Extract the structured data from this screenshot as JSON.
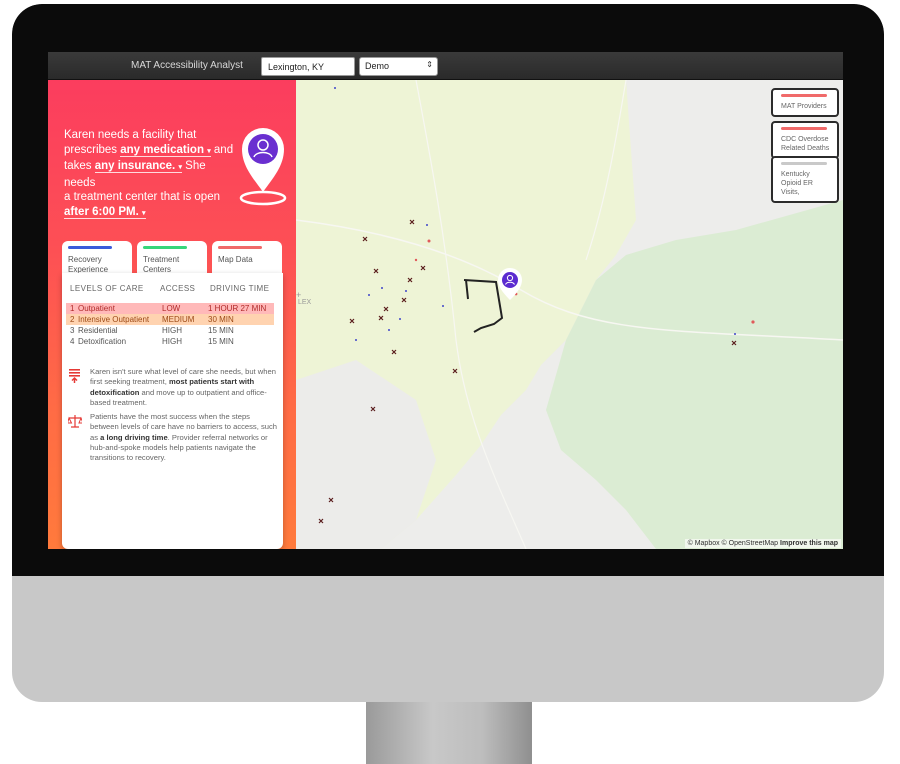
{
  "header": {
    "app_title": "MAT Accessibility Analyst",
    "city_value": "Lexington, KY",
    "mode_value": "Demo"
  },
  "story": {
    "line1": "Karen needs a facility that",
    "prescribes_prefix": "prescribes",
    "medication": "any medication",
    "and_text": "and",
    "takes_prefix": "takes",
    "insurance": "any insurance.",
    "she_needs": "She needs",
    "line4": "a treatment center that is open",
    "time": "after 6:00 PM.",
    "caret": "▾"
  },
  "tabs": [
    {
      "label": "Recovery Experience",
      "color": "#3b5bdb"
    },
    {
      "label": "Treatment Centers",
      "color": "#37d67a"
    },
    {
      "label": "Map Data",
      "color": "#f06a6a"
    }
  ],
  "table": {
    "headers": [
      "LEVELS OF CARE",
      "ACCESS",
      "DRIVING TIME"
    ],
    "rows": [
      {
        "num": "1",
        "level": "Outpatient",
        "access": "LOW",
        "time": "1 HOUR 27 MIN"
      },
      {
        "num": "2",
        "level": "Intensive Outpatient",
        "access": "MEDIUM",
        "time": "30 MIN"
      },
      {
        "num": "3",
        "level": "Residential",
        "access": "HIGH",
        "time": "15 MIN"
      },
      {
        "num": "4",
        "level": "Detoxification",
        "access": "HIGH",
        "time": "15 MIN"
      }
    ]
  },
  "notes": {
    "n1_a": "Karen isn't sure what level of care she needs, but when first seeking treatment,",
    "n1_b": "most patients start with detoxification",
    "n1_c": "and move up to outpatient and office-based treatment.",
    "n2_a": "Patients have the most success when the steps between levels of care have no barriers to access, such as",
    "n2_b": "a long driving time",
    "n2_c": ". Provider referral networks or hub-and-spoke models help patients navigate the transitions to recovery."
  },
  "legend": [
    {
      "label": "MAT Providers",
      "color": "#f06a6a"
    },
    {
      "label": "CDC Overdose Related Deaths",
      "color": "#f06a6a"
    },
    {
      "label": "Kentucky Opioid ER Visits,",
      "color": "#c9c9c9"
    }
  ],
  "map": {
    "attribution_a": "© Mapbox © OpenStreetMap",
    "attribution_b": "Improve this map",
    "lex_label": "LEX",
    "zoom_in": "+"
  },
  "colors": {
    "accent_gradient_top": "#fb3d5e",
    "accent_gradient_bottom": "#ff7a3c",
    "pin_purple": "#6a2fd0"
  }
}
